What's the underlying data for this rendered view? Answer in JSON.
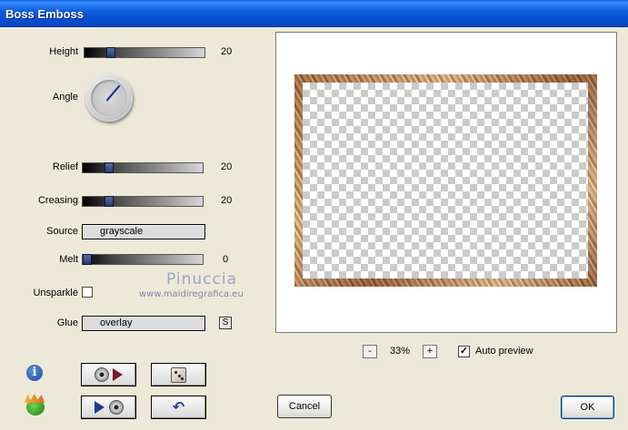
{
  "window": {
    "title": "Boss Emboss"
  },
  "controls": {
    "height": {
      "label": "Height",
      "value": "20",
      "level": 0.2
    },
    "angle": {
      "label": "Angle"
    },
    "relief": {
      "label": "Relief",
      "value": "20",
      "level": 0.2
    },
    "creasing": {
      "label": "Creasing",
      "value": "20",
      "level": 0.2
    },
    "source": {
      "label": "Source",
      "value": "grayscale"
    },
    "melt": {
      "label": "Melt",
      "value": "0",
      "level": 0
    },
    "unsparkle": {
      "label": "Unsparkle",
      "checked": false
    },
    "glue": {
      "label": "Glue",
      "value": "overlay",
      "s_button": "S"
    }
  },
  "watermark": {
    "line1": "Pinuccia",
    "line2": "www.maidiregrafica.eu"
  },
  "preview": {
    "zoom_minus": "-",
    "zoom_value": "33%",
    "zoom_plus": "+",
    "auto_preview_label": "Auto preview",
    "auto_preview_checked": true
  },
  "buttons": {
    "cancel": "Cancel",
    "ok": "OK"
  },
  "icons": {
    "info": "info-icon",
    "plugin_logo": "plugin-logo-icon",
    "dice": "dice-icon",
    "undo": "undo-icon"
  },
  "colors": {
    "titlebar": "#0b5bd9",
    "accent": "#1a3a9a"
  }
}
